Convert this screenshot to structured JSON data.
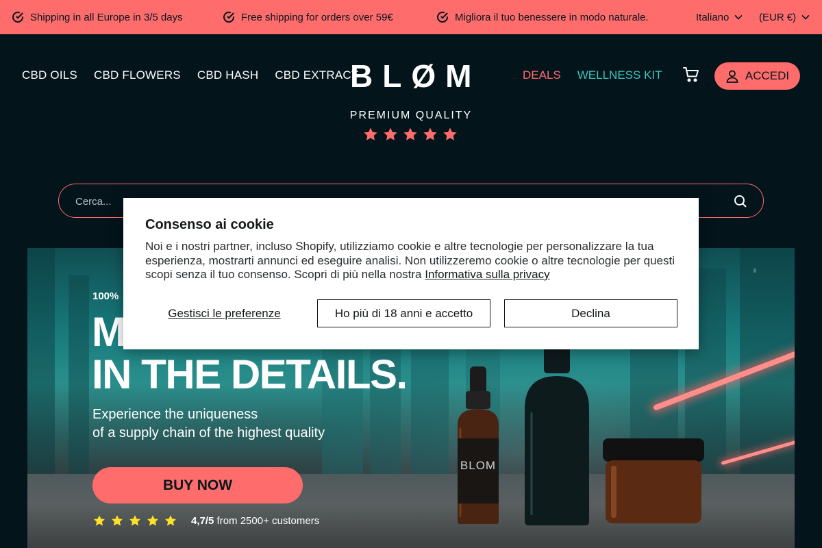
{
  "announcement": {
    "messages": [
      "Shipping in all Europe in 3/5 days",
      "Free shipping for orders over 59€",
      "Migliora il tuo benessere in modo naturale."
    ],
    "language": "Italiano",
    "currency": "(EUR €)",
    "icon": "check-circle-icon"
  },
  "header": {
    "nav_left": [
      "CBD OILS",
      "CBD FLOWERS",
      "CBD HASH",
      "CBD EXTRACT"
    ],
    "logo": "BLØM",
    "tagline": "PREMIUM QUALITY",
    "stars": 5,
    "nav_right": {
      "deals": "DEALS",
      "wellness": "WELLNESS KIT"
    },
    "login_label": "ACCEDI"
  },
  "search": {
    "placeholder": "Cerca..."
  },
  "hero": {
    "eyebrow": "100%",
    "headline_1": "M",
    "headline_2": "IN THE DETAILS.",
    "subtitle_line1": "Experience the uniqueness",
    "subtitle_line2": "of a supply chain of the highest quality",
    "cta": "BUY NOW",
    "rating_value": "4,7/5",
    "rating_suffix": "from 2500+ customers",
    "rating_stars": 5,
    "bottle_label": "BLOM"
  },
  "cookie": {
    "title": "Consenso ai cookie",
    "body": "Noi e i nostri partner, incluso Shopify, utilizziamo cookie e altre tecnologie per personalizzare la tua esperienza, mostrarti annunci ed eseguire analisi. Non utilizzeremo cookie o altre tecnologie per questi scopi senza il tuo consenso. Scopri di più nella nostra",
    "privacy_link": "Informativa sulla privacy",
    "manage": "Gestisci le preferenze",
    "accept": "Ho più di 18 anni e accetto",
    "decline": "Declina"
  },
  "colors": {
    "accent": "#ff6c6c",
    "background": "#04141b",
    "teal": "#3bc8c0"
  }
}
